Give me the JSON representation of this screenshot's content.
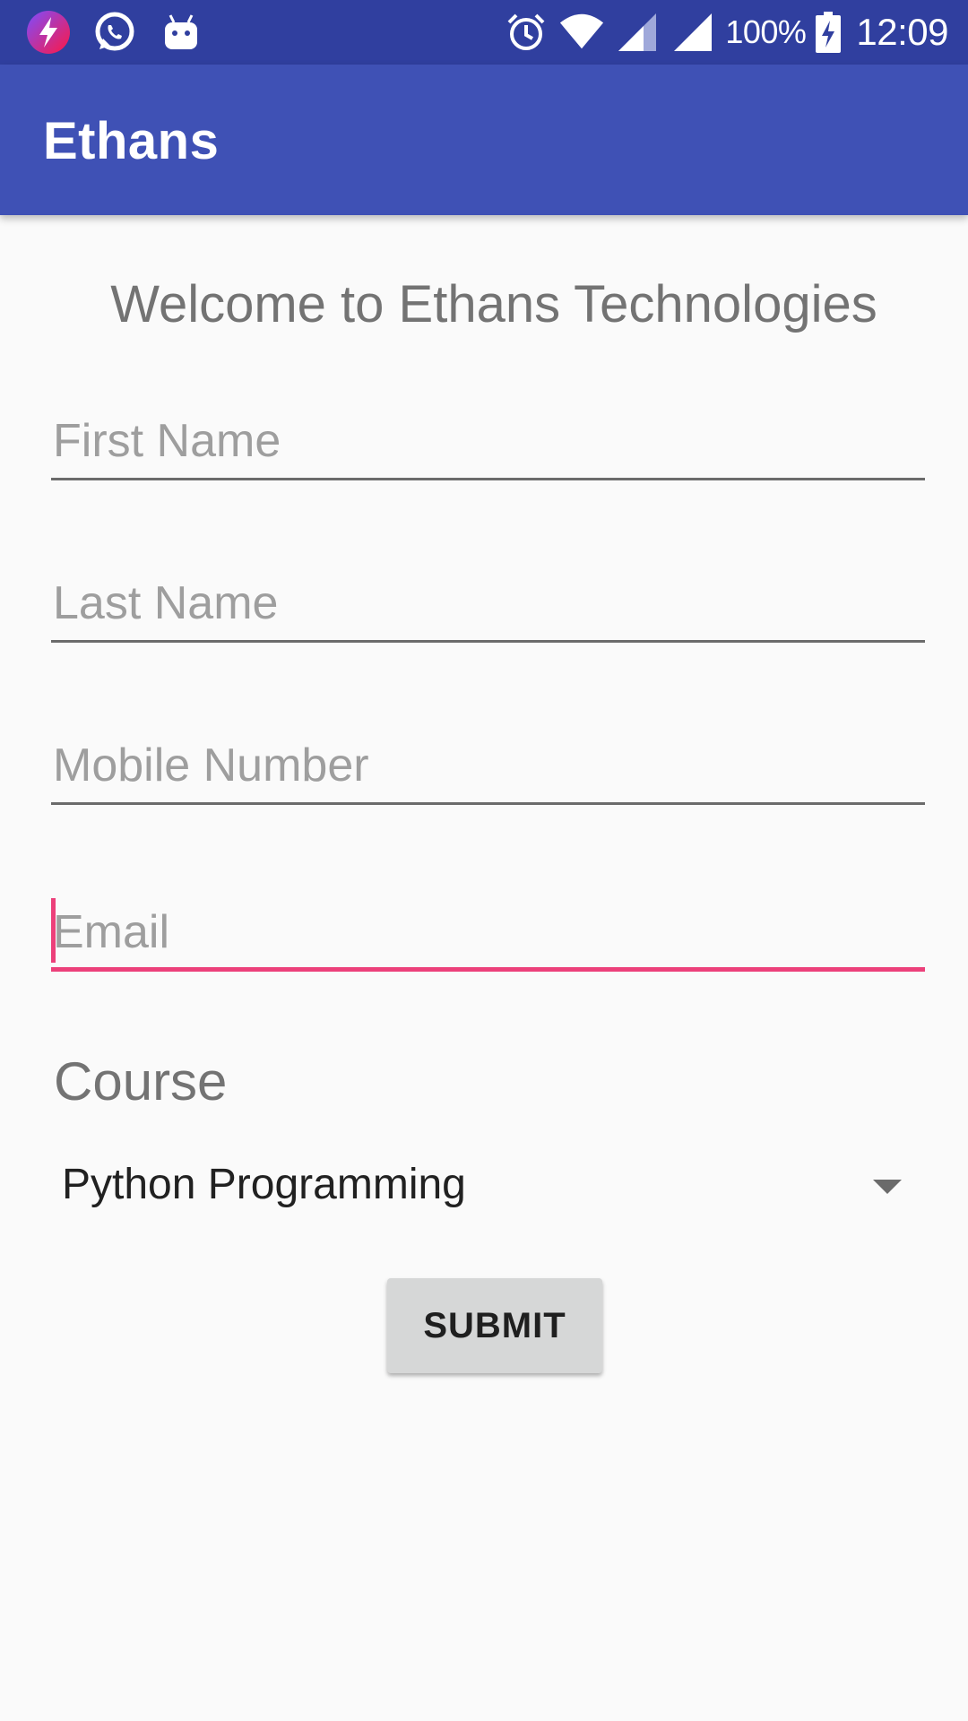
{
  "status_bar": {
    "left_icons": [
      "app-bolt-icon",
      "whatsapp-icon",
      "android-debug-icon"
    ],
    "right_icons": [
      "alarm-icon",
      "wifi-icon",
      "signal-icon",
      "signal-icon",
      "battery-charging-icon"
    ],
    "battery": "100%",
    "time": "12:09"
  },
  "app_bar": {
    "title": "Ethans"
  },
  "form": {
    "welcome": "Welcome to Ethans Technologies",
    "first_name_hint": "First Name",
    "last_name_hint": "Last Name",
    "mobile_hint": "Mobile Number",
    "email_hint": "Email",
    "course_label": "Course",
    "course_selected": "Python Programming",
    "submit_label": "SUBMIT"
  },
  "colors": {
    "status_bar": "#303f9f",
    "app_bar": "#3f51b5",
    "accent": "#ec407a",
    "background": "#fafafa"
  }
}
